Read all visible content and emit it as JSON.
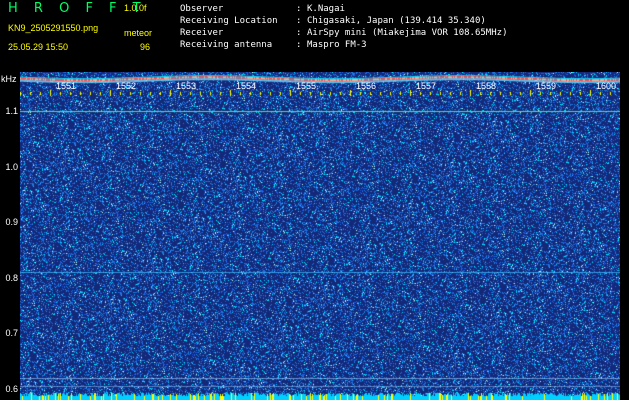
{
  "header": {
    "app_title": "H R O F F T",
    "version": "1.0.0f",
    "filename": "KN9_2505291550.png",
    "label_meteor": "meteor",
    "timestamp": "25.05.29 15:50",
    "meteor_count": "96"
  },
  "meta": [
    {
      "label": "Observer",
      "sep": ":",
      "value": "K.Nagai"
    },
    {
      "label": "Receiving Location",
      "sep": ":",
      "value": "Chigasaki, Japan (139.414 35.340)"
    },
    {
      "label": "Receiver",
      "sep": ":",
      "value": "AirSpy mini (Miakejima VOR 108.65MHz)"
    },
    {
      "label": "Receiving antenna",
      "sep": ":",
      "value": "Maspro FM-3"
    }
  ],
  "spectrogram": {
    "y_unit": "kHz",
    "y_ticks": [
      "1.1",
      "1.0",
      "0.9",
      "0.8",
      "0.7",
      "0.6"
    ],
    "y_range": [
      0.58,
      1.17
    ],
    "x_ticks": [
      "1551",
      "1552",
      "1553",
      "1554",
      "1555",
      "1556",
      "1557",
      "1558",
      "1559",
      "1600"
    ],
    "colors": {
      "background": "#14287a",
      "noise_low": "#2050d8",
      "noise_high": "#00e0ff",
      "carrier": "#ff5050",
      "bottom_bar": "#00d0ff",
      "bottom_bar_hot": "#ffff00",
      "tick_marker": "#ffff00"
    }
  }
}
